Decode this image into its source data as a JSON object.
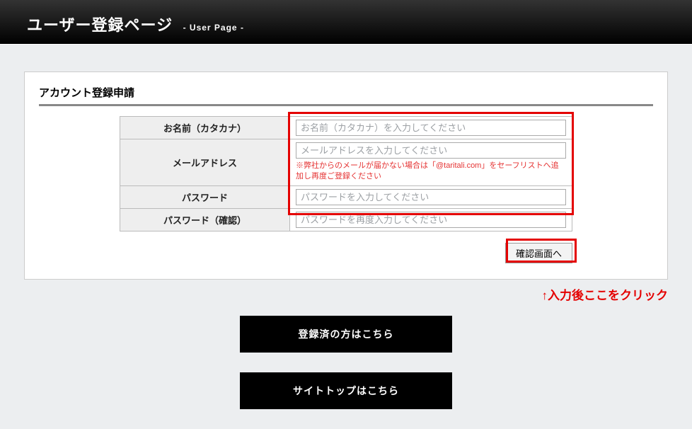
{
  "header": {
    "title": "ユーザー登録ページ",
    "subtitle": "- User Page -"
  },
  "section": {
    "title": "アカウント登録申請"
  },
  "form": {
    "name_label": "お名前（カタカナ）",
    "name_placeholder": "お名前（カタカナ）を入力してください",
    "email_label": "メールアドレス",
    "email_placeholder": "メールアドレスを入力してください",
    "email_hint": "※弊社からのメールが届かない場合は「@taritali.com」をセーフリストへ追加し再度ご登録ください",
    "password_label": "パスワード",
    "password_placeholder": "パスワードを入力してください",
    "password_confirm_label": "パスワード（確認）",
    "password_confirm_placeholder": "パスワードを再度入力してください",
    "confirm_button": "確認画面へ"
  },
  "annotation": "↑入力後ここをクリック",
  "nav": {
    "login_button": "登録済の方はこちら",
    "top_button": "サイトトップはこちら"
  }
}
